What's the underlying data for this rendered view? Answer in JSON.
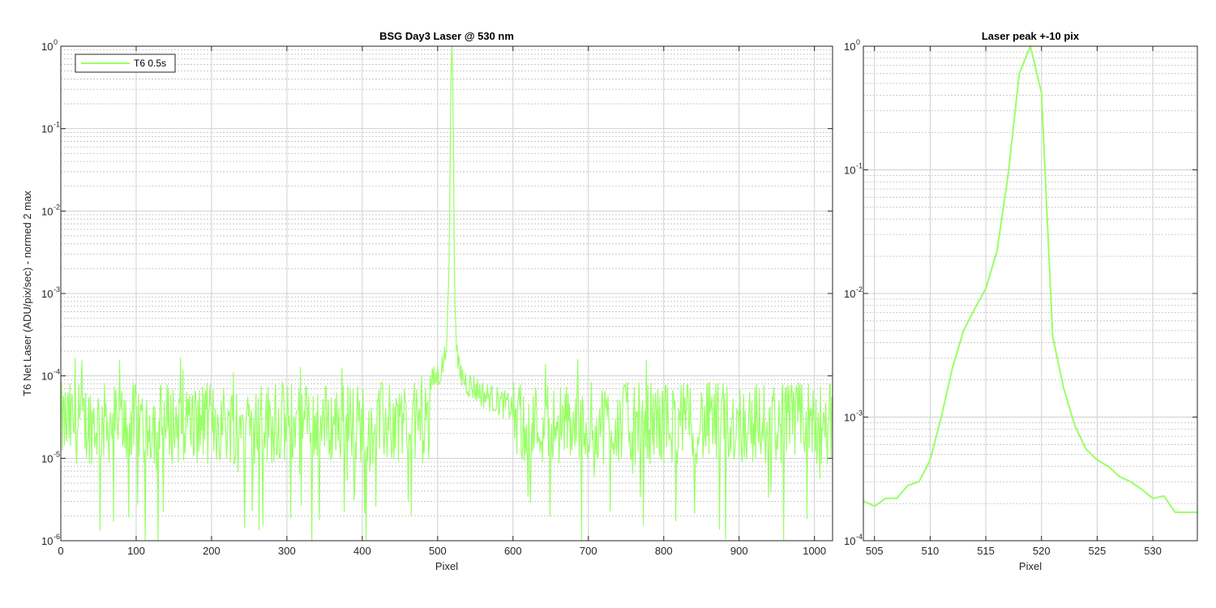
{
  "colors": {
    "series": "#99ff66",
    "axis": "#262626",
    "background": "#ffffff"
  },
  "chart_data": [
    {
      "type": "line",
      "title": "BSG  Day3 Laser @ 530 nm",
      "xlabel": "Pixel",
      "ylabel": "T6 Net Laser (ADU/pix/sec) - normed 2 max",
      "xlim": [
        0,
        1024
      ],
      "ylim": [
        1e-06,
        1
      ],
      "yscale": "log",
      "grid": true,
      "x_ticks": [
        0,
        100,
        200,
        300,
        400,
        500,
        600,
        700,
        800,
        900,
        1000
      ],
      "x_tick_labels": [
        "0",
        "100",
        "200",
        "300",
        "400",
        "500",
        "600",
        "700",
        "800",
        "900",
        "1000"
      ],
      "y_ticks": [
        {
          "value": 1,
          "base": "10",
          "exp": "0"
        },
        {
          "value": 0.1,
          "base": "10",
          "exp": "-1"
        },
        {
          "value": 0.01,
          "base": "10",
          "exp": "-2"
        },
        {
          "value": 0.001,
          "base": "10",
          "exp": "-3"
        },
        {
          "value": 0.0001,
          "base": "10",
          "exp": "-4"
        },
        {
          "value": 1e-05,
          "base": "10",
          "exp": "-5"
        },
        {
          "value": 1e-06,
          "base": "10",
          "exp": "-6"
        }
      ],
      "legend": {
        "location": "top-left",
        "entries": [
          "T6 0.5s"
        ]
      },
      "series": [
        {
          "name": "T6 0.5s",
          "noise_floor": 3e-05,
          "x": [
            490,
            500,
            505,
            510,
            513,
            515,
            516,
            517,
            518,
            519,
            520,
            521,
            522,
            523,
            525,
            528,
            532,
            540,
            550,
            560,
            600
          ],
          "y": [
            8e-05,
            0.0001,
            0.00012,
            0.00018,
            0.0005,
            0.002,
            0.01,
            0.1,
            0.6,
            1.0,
            0.4,
            0.05,
            0.004,
            0.0008,
            0.0002,
            0.00012,
            0.0001,
            8e-05,
            7e-05,
            6e-05,
            4e-05
          ]
        }
      ]
    },
    {
      "type": "line",
      "title": "Laser peak +-10 pix",
      "xlabel": "Pixel",
      "ylabel": "",
      "xlim": [
        504,
        534
      ],
      "ylim": [
        0.0001,
        1
      ],
      "yscale": "log",
      "grid": true,
      "x_ticks": [
        505,
        510,
        515,
        520,
        525,
        530
      ],
      "x_tick_labels": [
        "505",
        "510",
        "515",
        "520",
        "525",
        "530"
      ],
      "y_ticks": [
        {
          "value": 1,
          "base": "10",
          "exp": "0"
        },
        {
          "value": 0.1,
          "base": "10",
          "exp": "-1"
        },
        {
          "value": 0.01,
          "base": "10",
          "exp": "-2"
        },
        {
          "value": 0.001,
          "base": "10",
          "exp": "-3"
        },
        {
          "value": 0.0001,
          "base": "10",
          "exp": "-4"
        }
      ],
      "series": [
        {
          "name": "T6 0.5s",
          "x": [
            504,
            505,
            506,
            507,
            508,
            509,
            510,
            511,
            512,
            513,
            514,
            515,
            516,
            517,
            518,
            519,
            520,
            521,
            522,
            523,
            524,
            525,
            526,
            527,
            528,
            529,
            530,
            531,
            532,
            533,
            534
          ],
          "y": [
            0.00021,
            0.00019,
            0.00022,
            0.00022,
            0.00028,
            0.0003,
            0.00045,
            0.001,
            0.0025,
            0.005,
            0.0075,
            0.011,
            0.022,
            0.09,
            0.6,
            1.0,
            0.42,
            0.0045,
            0.0017,
            0.00085,
            0.00055,
            0.00045,
            0.0004,
            0.00033,
            0.0003,
            0.00026,
            0.00022,
            0.00023,
            0.00017,
            0.00017,
            0.00017
          ]
        }
      ]
    }
  ]
}
